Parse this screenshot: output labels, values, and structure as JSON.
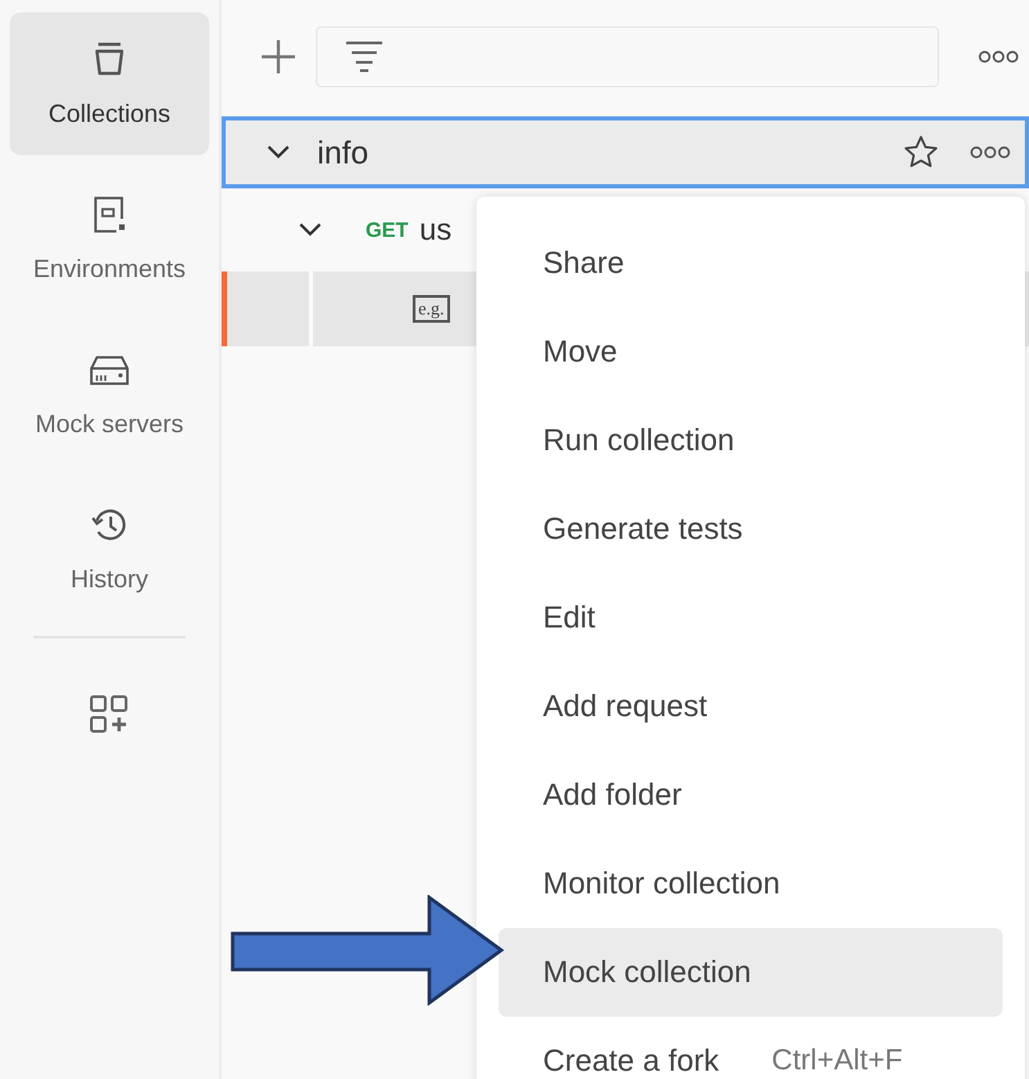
{
  "sidebar": {
    "items": [
      {
        "kind": "collections",
        "label": "Collections",
        "selected": true
      },
      {
        "kind": "environments",
        "label": "Environments",
        "selected": false
      },
      {
        "kind": "mock",
        "label": "Mock servers",
        "selected": false
      },
      {
        "kind": "history",
        "label": "History",
        "selected": false
      }
    ]
  },
  "collection": {
    "name": "info",
    "expanded": true,
    "selected": true
  },
  "request": {
    "method": "GET",
    "name": "us",
    "expanded": true
  },
  "example": {
    "badge": "e.g.",
    "selected": true
  },
  "context_menu": {
    "items": [
      {
        "label": "Share",
        "selected": false
      },
      {
        "label": "Move",
        "selected": false
      },
      {
        "label": "Run collection",
        "selected": false
      },
      {
        "label": "Generate tests",
        "selected": false
      },
      {
        "label": "Edit",
        "selected": false
      },
      {
        "label": "Add request",
        "selected": false
      },
      {
        "label": "Add folder",
        "selected": false
      },
      {
        "label": "Monitor collection",
        "selected": false
      },
      {
        "label": "Mock collection",
        "selected": true
      },
      {
        "label": "Create a fork",
        "shortcut": "Ctrl+Alt+F",
        "selected": false
      }
    ]
  }
}
